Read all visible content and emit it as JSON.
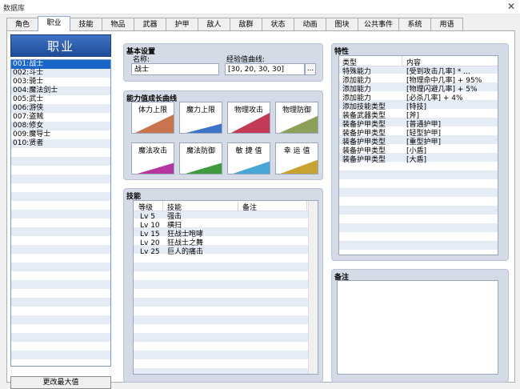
{
  "window": {
    "title": "数据库"
  },
  "tabs": [
    {
      "label": "角色"
    },
    {
      "label": "职业"
    },
    {
      "label": "技能"
    },
    {
      "label": "物品"
    },
    {
      "label": "武器"
    },
    {
      "label": "护甲"
    },
    {
      "label": "敌人"
    },
    {
      "label": "敌群"
    },
    {
      "label": "状态"
    },
    {
      "label": "动画"
    },
    {
      "label": "图块"
    },
    {
      "label": "公共事件"
    },
    {
      "label": "系统"
    },
    {
      "label": "用语"
    }
  ],
  "class_panel": {
    "header": "职业",
    "items": [
      "001:战士",
      "002:斗士",
      "003:骑士",
      "004:魔法剑士",
      "005:武士",
      "006:游侠",
      "007:盗贼",
      "008:修女",
      "009:魔导士",
      "010:贤者"
    ],
    "max_button": "更改最大值"
  },
  "basic": {
    "title": "基本设置",
    "name_label": "名称:",
    "name_value": "战士",
    "exp_label": "经验值曲线:",
    "exp_value": "[30, 20, 30, 30]",
    "exp_button": "..."
  },
  "params": {
    "title": "能力值成长曲线",
    "curves": [
      {
        "label": "体力上限",
        "color": "#c8744f"
      },
      {
        "label": "魔力上限",
        "color": "#3d73c9"
      },
      {
        "label": "物理攻击",
        "color": "#c23a55"
      },
      {
        "label": "物理防御",
        "color": "#8ca05a"
      },
      {
        "label": "魔法攻击",
        "color": "#b5369e"
      },
      {
        "label": "魔法防御",
        "color": "#3f9a3c"
      },
      {
        "label": "敏 捷 值",
        "color": "#4ba6d8"
      },
      {
        "label": "幸 运 值",
        "color": "#c9a332"
      }
    ]
  },
  "skills": {
    "title": "技能",
    "headers": {
      "level": "等级",
      "skill": "技能",
      "note": "备注"
    },
    "rows": [
      {
        "level": "Lv  5",
        "skill": "强击"
      },
      {
        "level": "Lv 10",
        "skill": "横扫"
      },
      {
        "level": "Lv 15",
        "skill": "狂战士咆哮"
      },
      {
        "level": "Lv 20",
        "skill": "狂战士之舞"
      },
      {
        "level": "Lv 25",
        "skill": "巨人的痛击"
      }
    ]
  },
  "traits": {
    "title": "特性",
    "headers": {
      "type": "类型",
      "content": "内容"
    },
    "rows": [
      {
        "type": "特殊能力",
        "content": "[受到攻击几率] * ..."
      },
      {
        "type": "添加能力",
        "content": "[物理命中几率] + 95%"
      },
      {
        "type": "添加能力",
        "content": "[物理闪避几率] + 5%"
      },
      {
        "type": "添加能力",
        "content": "[必杀几率] + 4%"
      },
      {
        "type": "添加技能类型",
        "content": "[特技]"
      },
      {
        "type": "装备武器类型",
        "content": "[斧]"
      },
      {
        "type": "装备护甲类型",
        "content": "[普通护甲]"
      },
      {
        "type": "装备护甲类型",
        "content": "[轻型护甲]"
      },
      {
        "type": "装备护甲类型",
        "content": "[重型护甲]"
      },
      {
        "type": "装备护甲类型",
        "content": "[小盾]"
      },
      {
        "type": "装备护甲类型",
        "content": "[大盾]"
      }
    ]
  },
  "note": {
    "title": "备注"
  }
}
